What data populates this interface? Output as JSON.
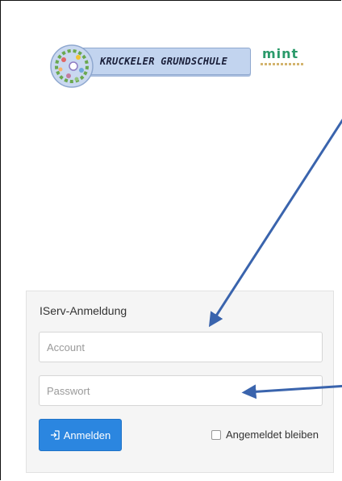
{
  "header": {
    "school_name": "KRUCKELER GRUNDSCHULE",
    "mint_logo_text": "mint"
  },
  "login": {
    "title": "IServ-Anmeldung",
    "account_placeholder": "Account",
    "password_placeholder": "Passwort",
    "submit_label": "Anmelden",
    "remember_label": "Angemeldet bleiben"
  },
  "colors": {
    "primary_button": "#2b86e0",
    "annotation_arrow": "#3a64ad",
    "banner": "#c2d4ef",
    "mint": "#2a9a6a"
  }
}
